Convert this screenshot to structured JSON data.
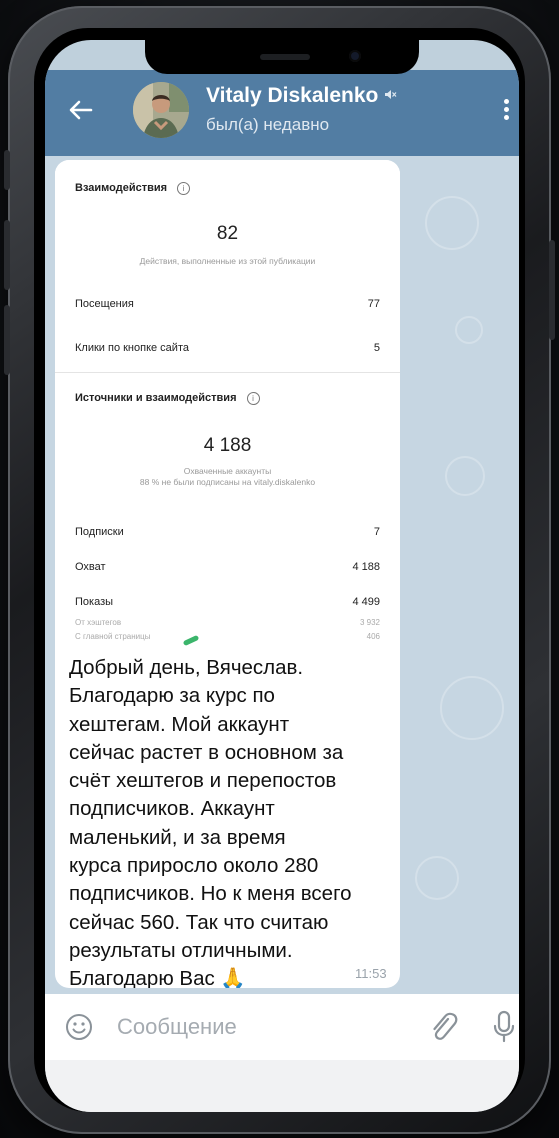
{
  "header": {
    "contact_name": "Vitaly Diskalenko",
    "status": "был(а) недавно",
    "mute_icon": "🔇"
  },
  "insights": {
    "interactions_title": "Взаимодействия",
    "info_glyph": "i",
    "interactions_total": "82",
    "interactions_caption": "Действия, выполненные из этой публикации",
    "rows_top": [
      {
        "label": "Посещения",
        "value": "77"
      },
      {
        "label": "Клики по кнопке сайта",
        "value": "5"
      }
    ],
    "sources_title": "Источники и взаимодействия",
    "reach_total": "4 188",
    "reach_caption_1": "Охваченные аккаунты",
    "reach_caption_2": "88 % не были подписаны на vitaly.diskalenko",
    "rows_bottom": [
      {
        "label": "Подписки",
        "value": "7"
      },
      {
        "label": "Охват",
        "value": "4 188"
      },
      {
        "label": "Показы",
        "value": "4 499"
      }
    ],
    "subrows": [
      {
        "label": "От хэштегов",
        "value": "3 932"
      },
      {
        "label": "С главной страницы",
        "value": "406"
      }
    ]
  },
  "message": {
    "lines": [
      "Добрый день, Вячеслав.",
      "Благодарю за курс по",
      "хештегам. Мой аккаунт",
      "сейчас растет в основном за",
      "счёт хештегов и перепостов",
      "подписчиков. Аккаунт",
      "маленький, и за время",
      "курса приросло около 280",
      "подписчиков. Но к меня всего",
      "сейчас 560. Так что считаю",
      "результаты отличными.",
      "Благодарю Вас 🙏"
    ],
    "time": "11:53"
  },
  "composer": {
    "placeholder": "Сообщение"
  },
  "colors": {
    "header": "#527da3",
    "chat_background": "#c6d6e2"
  },
  "icons": [
    "back-arrow-icon",
    "mute-icon",
    "more-vert-icon",
    "info-icon",
    "emoji-icon",
    "attach-icon",
    "mic-icon"
  ]
}
